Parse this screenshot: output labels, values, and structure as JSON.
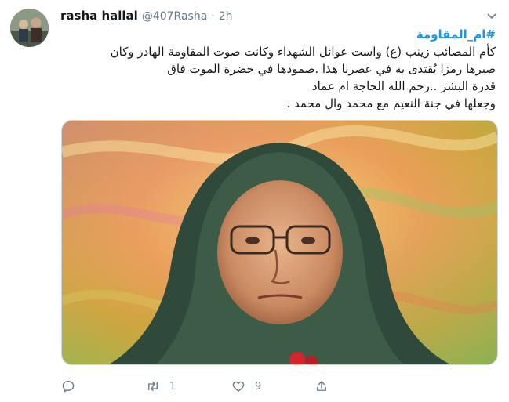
{
  "tweet": {
    "user_name": "rasha hallal",
    "handle": "@407Rasha",
    "separator": "·",
    "time": "2h",
    "hashtag": "#ام_المقاومة",
    "lines": [
      "كأم المصائب زينب (ع) واست عوائل الشهداء وكانت صوت المقاومة الهادر وكان",
      "صبرها رمزا يُقتدى به في عصرنا هذا .صمودها في حضرة الموت فاق",
      "قدرة البشر ..رحم الله الحاجة ام عماد",
      "وجعلها في جنة النعيم مع محمد وال محمد ."
    ]
  },
  "actions": {
    "reply_count": "",
    "retweet_count": "1",
    "like_count": "9"
  },
  "colors": {
    "link": "#1b95e0",
    "muted": "#657786",
    "border": "#ccd6dd"
  },
  "icons": [
    "avatar",
    "caret-down-icon",
    "reply-icon",
    "retweet-icon",
    "like-icon",
    "share-icon"
  ]
}
